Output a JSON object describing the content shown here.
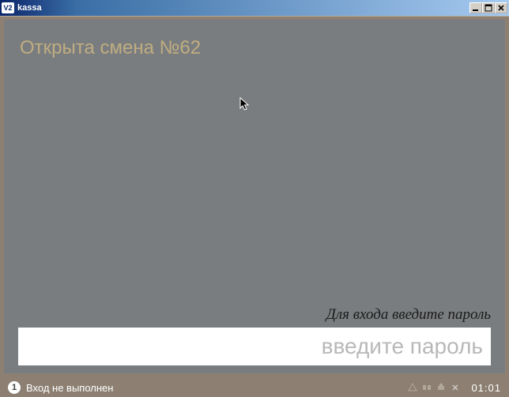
{
  "window": {
    "app_icon_text": "V2",
    "title": "kassa"
  },
  "main": {
    "shift_title": "Открыта смена №62",
    "login_prompt": "Для входа введите пароль",
    "password_placeholder": "введите пароль",
    "password_value": ""
  },
  "footer": {
    "pos_number": "1",
    "status_text": "Вход не выполнен",
    "time": "01:01"
  }
}
